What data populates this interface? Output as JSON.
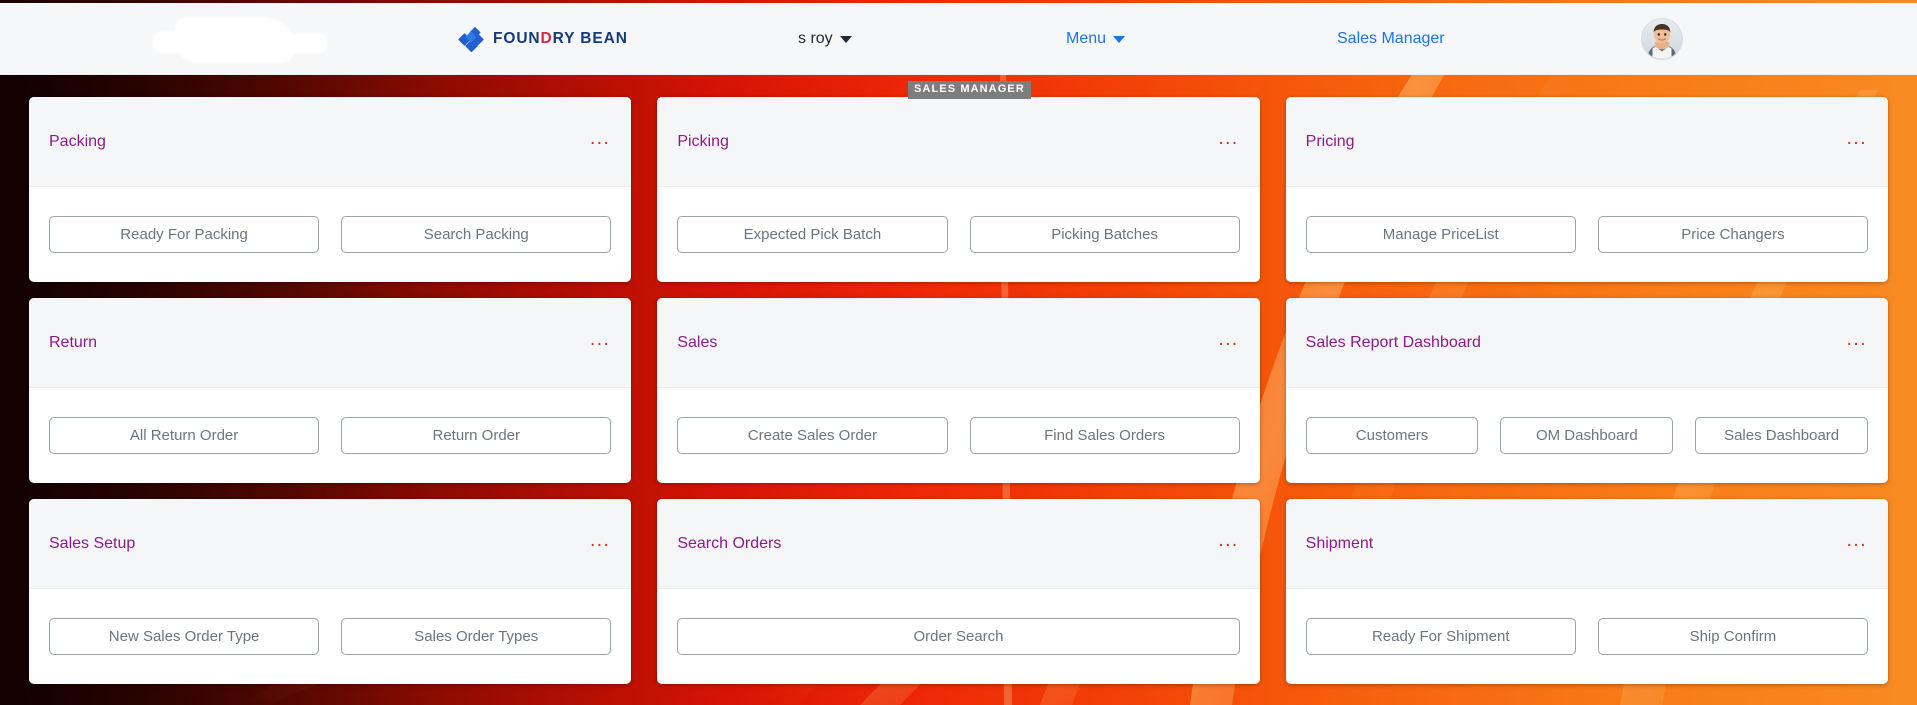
{
  "header": {
    "logo": {
      "icon": "diamond-cluster-logo-icon",
      "text_before": "FOUN",
      "text_accent": "D",
      "text_after": "RY BEAN"
    },
    "user_menu": {
      "label": "s roy",
      "caret": "chevron-down-icon"
    },
    "menu": {
      "label": "Menu",
      "caret": "chevron-down-icon"
    },
    "role": {
      "label": "Sales Manager"
    },
    "avatar": {
      "name": "user-avatar"
    },
    "redacted_region": {
      "name": "redacted-logo-blob"
    }
  },
  "section_badge": {
    "label": "SALES MANAGER"
  },
  "colors": {
    "card_title": "#8c1a8c",
    "card_menu": "#d32b1e",
    "link_blue": "#1a73e8",
    "badge_bg": "#7d7d7d",
    "bg_left": "#1a0200",
    "bg_mid": "#ee2806",
    "bg_right": "#f98a22"
  },
  "cards": [
    {
      "title": "Packing",
      "menu": "...",
      "buttons": [
        {
          "label": "Ready For Packing"
        },
        {
          "label": "Search Packing"
        }
      ]
    },
    {
      "title": "Picking",
      "menu": "...",
      "buttons": [
        {
          "label": "Expected Pick Batch"
        },
        {
          "label": "Picking Batches"
        }
      ]
    },
    {
      "title": "Pricing",
      "menu": "...",
      "buttons": [
        {
          "label": "Manage PriceList"
        },
        {
          "label": "Price Changers"
        }
      ]
    },
    {
      "title": "Return",
      "menu": "...",
      "buttons": [
        {
          "label": "All Return Order"
        },
        {
          "label": "Return Order"
        }
      ]
    },
    {
      "title": "Sales",
      "menu": "...",
      "buttons": [
        {
          "label": "Create Sales Order"
        },
        {
          "label": "Find Sales Orders"
        }
      ]
    },
    {
      "title": "Sales Report Dashboard",
      "menu": "...",
      "buttons": [
        {
          "label": "Customers"
        },
        {
          "label": "OM Dashboard"
        },
        {
          "label": "Sales Dashboard"
        }
      ]
    },
    {
      "title": "Sales Setup",
      "menu": "...",
      "buttons": [
        {
          "label": "New Sales Order Type"
        },
        {
          "label": "Sales Order Types"
        }
      ]
    },
    {
      "title": "Search Orders",
      "menu": "...",
      "buttons": [
        {
          "label": "Order Search"
        }
      ]
    },
    {
      "title": "Shipment",
      "menu": "...",
      "buttons": [
        {
          "label": "Ready For Shipment"
        },
        {
          "label": "Ship Confirm"
        }
      ]
    }
  ]
}
